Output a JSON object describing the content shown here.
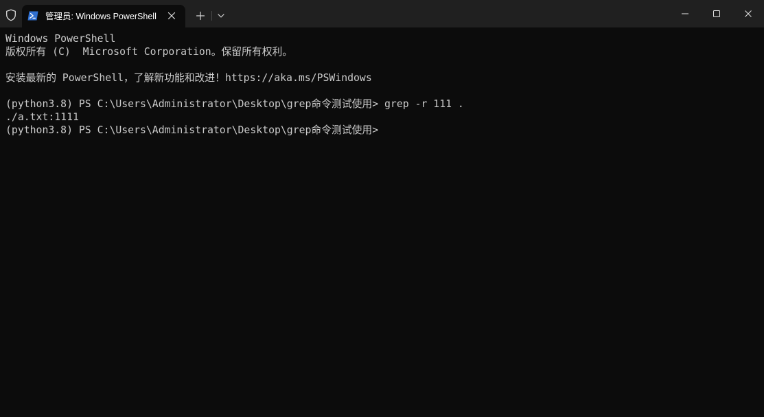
{
  "window": {
    "tab_title": "管理员: Windows PowerShell",
    "icons": {
      "shield": "shield-icon",
      "tab": "powershell-icon",
      "close_tab": "close-icon",
      "new_tab": "plus-icon",
      "dropdown": "chevron-down-icon",
      "minimize": "minimize-icon",
      "maximize": "maximize-icon",
      "close_window": "close-icon"
    },
    "colors": {
      "titlebar_bg": "#202020",
      "terminal_bg": "#0c0c0c",
      "text": "#cccccc",
      "ps_icon_bg": "#2f6fd0"
    }
  },
  "terminal": {
    "lines": [
      "Windows PowerShell",
      "版权所有 (C)  Microsoft Corporation。保留所有权利。",
      "",
      "安装最新的 PowerShell，了解新功能和改进！https://aka.ms/PSWindows",
      "",
      "(python3.8) PS C:\\Users\\Administrator\\Desktop\\grep命令测试使用> grep -r 111 .",
      "./a.txt:1111",
      "(python3.8) PS C:\\Users\\Administrator\\Desktop\\grep命令测试使用>"
    ]
  }
}
